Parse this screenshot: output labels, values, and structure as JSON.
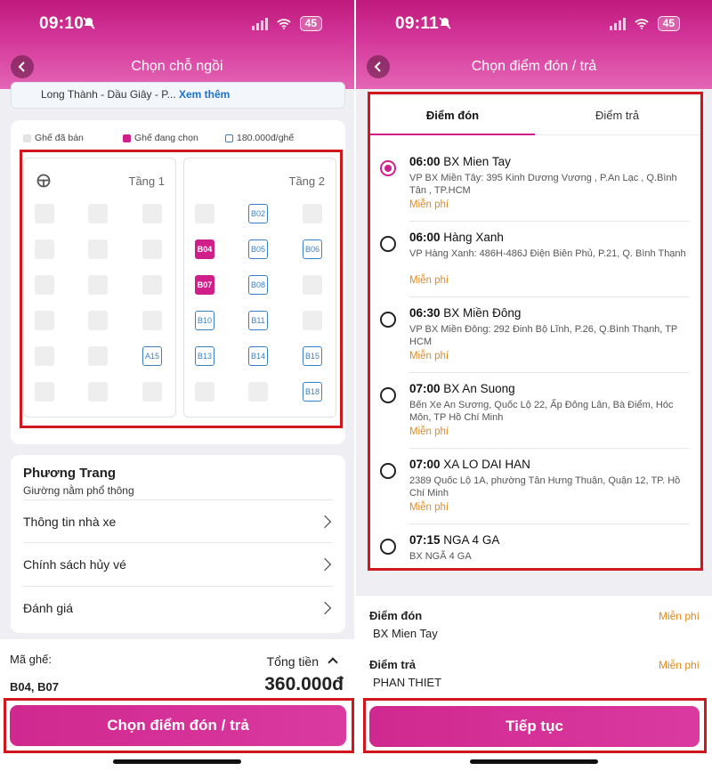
{
  "left": {
    "status": {
      "time": "09:10",
      "battery": "45"
    },
    "title": "Chọn chỗ ngồi",
    "route": {
      "text": "Long Thành - Dầu Giây - P...",
      "more": "Xem thêm"
    },
    "legend": {
      "sold": "Ghế đã bán",
      "selected": "Ghế đang chọn",
      "available": "180.000đ/ghế"
    },
    "decks": [
      {
        "label": "Tầng 1",
        "rows": [
          [
            {
              "code": "",
              "state": "sold"
            },
            {
              "code": "",
              "state": "sold"
            },
            {
              "code": "",
              "state": "sold"
            }
          ],
          [
            {
              "code": "",
              "state": "sold"
            },
            {
              "code": "",
              "state": "sold"
            },
            {
              "code": "",
              "state": "sold"
            }
          ],
          [
            {
              "code": "",
              "state": "sold"
            },
            {
              "code": "",
              "state": "sold"
            },
            {
              "code": "",
              "state": "sold"
            }
          ],
          [
            {
              "code": "",
              "state": "sold"
            },
            {
              "code": "",
              "state": "sold"
            },
            {
              "code": "",
              "state": "sold"
            }
          ],
          [
            {
              "code": "",
              "state": "sold"
            },
            {
              "code": "",
              "state": "sold"
            },
            {
              "code": "A15",
              "state": "avail"
            }
          ],
          [
            {
              "code": "",
              "state": "sold"
            },
            {
              "code": "",
              "state": "sold"
            },
            {
              "code": "",
              "state": "sold"
            }
          ]
        ]
      },
      {
        "label": "Tầng 2",
        "rows": [
          [
            {
              "code": "",
              "state": "sold"
            },
            {
              "code": "B02",
              "state": "avail"
            },
            {
              "code": "",
              "state": "sold"
            }
          ],
          [
            {
              "code": "B04",
              "state": "selected"
            },
            {
              "code": "B05",
              "state": "avail"
            },
            {
              "code": "B06",
              "state": "avail"
            }
          ],
          [
            {
              "code": "B07",
              "state": "selected"
            },
            {
              "code": "B08",
              "state": "avail"
            },
            {
              "code": "",
              "state": "sold"
            }
          ],
          [
            {
              "code": "B10",
              "state": "avail"
            },
            {
              "code": "B11",
              "state": "avail"
            },
            {
              "code": "",
              "state": "sold"
            }
          ],
          [
            {
              "code": "B13",
              "state": "avail"
            },
            {
              "code": "B14",
              "state": "avail"
            },
            {
              "code": "B15",
              "state": "avail"
            }
          ],
          [
            {
              "code": "",
              "state": "sold"
            },
            {
              "code": "",
              "state": "sold"
            },
            {
              "code": "B18",
              "state": "avail"
            }
          ]
        ]
      }
    ],
    "operator": {
      "name": "Phương Trang",
      "type": "Giường nằm phổ thông"
    },
    "info_rows": [
      "Thông tin nhà xe",
      "Chính sách hủy vé",
      "Đánh giá"
    ],
    "seat_code_label": "Mã ghế:",
    "seat_codes": "B04, B07",
    "total_label": "Tổng tiền",
    "total": "360.000đ",
    "cta": "Chọn điểm đón / trả"
  },
  "right": {
    "status": {
      "time": "09:11",
      "battery": "45"
    },
    "title": "Chọn điểm đón / trả",
    "tabs": [
      "Điểm đón",
      "Điểm trả"
    ],
    "stops": [
      {
        "time": "06:00",
        "name": "BX Mien Tay",
        "addr": "VP BX Miền Tây: 395 Kinh Dương Vương , P.An Lạc , Q.Bình Tân , TP.HCM",
        "fee": "Miễn phí",
        "selected": true
      },
      {
        "time": "06:00",
        "name": "Hàng Xanh",
        "addr": "VP Hàng Xanh: 486H-486J Điện Biên Phủ, P.21, Q. Bình Thạnh",
        "fee": "Miễn phí",
        "selected": false
      },
      {
        "time": "06:30",
        "name": "BX Miền Đông",
        "addr": "VP BX Miền Đông: 292 Đinh Bộ Lĩnh, P.26, Q.Bình Thạnh, TP HCM",
        "fee": "Miễn phí",
        "selected": false
      },
      {
        "time": "07:00",
        "name": "BX An Suong",
        "addr": "Bến Xe An Sương, Quốc Lộ 22, Ấp Đông Lân, Bà Điểm, Hóc Môn, TP Hồ Chí Minh",
        "fee": "Miễn phí",
        "selected": false
      },
      {
        "time": "07:00",
        "name": "XA LO DAI HAN",
        "addr": "2389 Quốc Lộ 1A, phường Tân Hưng Thuận, Quận 12, TP. Hồ Chí Minh",
        "fee": "Miễn phí",
        "selected": false
      },
      {
        "time": "07:15",
        "name": "NGA 4 GA",
        "addr": "BX NGÃ 4 GA",
        "fee": "",
        "selected": false
      }
    ],
    "summary": {
      "pickup_label": "Điểm đón",
      "pickup_value": "BX Mien Tay",
      "pickup_fee": "Miễn phí",
      "dropoff_label": "Điểm trả",
      "dropoff_value": "PHAN THIET",
      "dropoff_fee": "Miễn phí"
    },
    "cta": "Tiếp tục"
  },
  "colors": {
    "brand": "#d01e8a",
    "highlight": "#d2161e",
    "fee": "#e28a1c",
    "seat_border": "#3a7fc4"
  }
}
